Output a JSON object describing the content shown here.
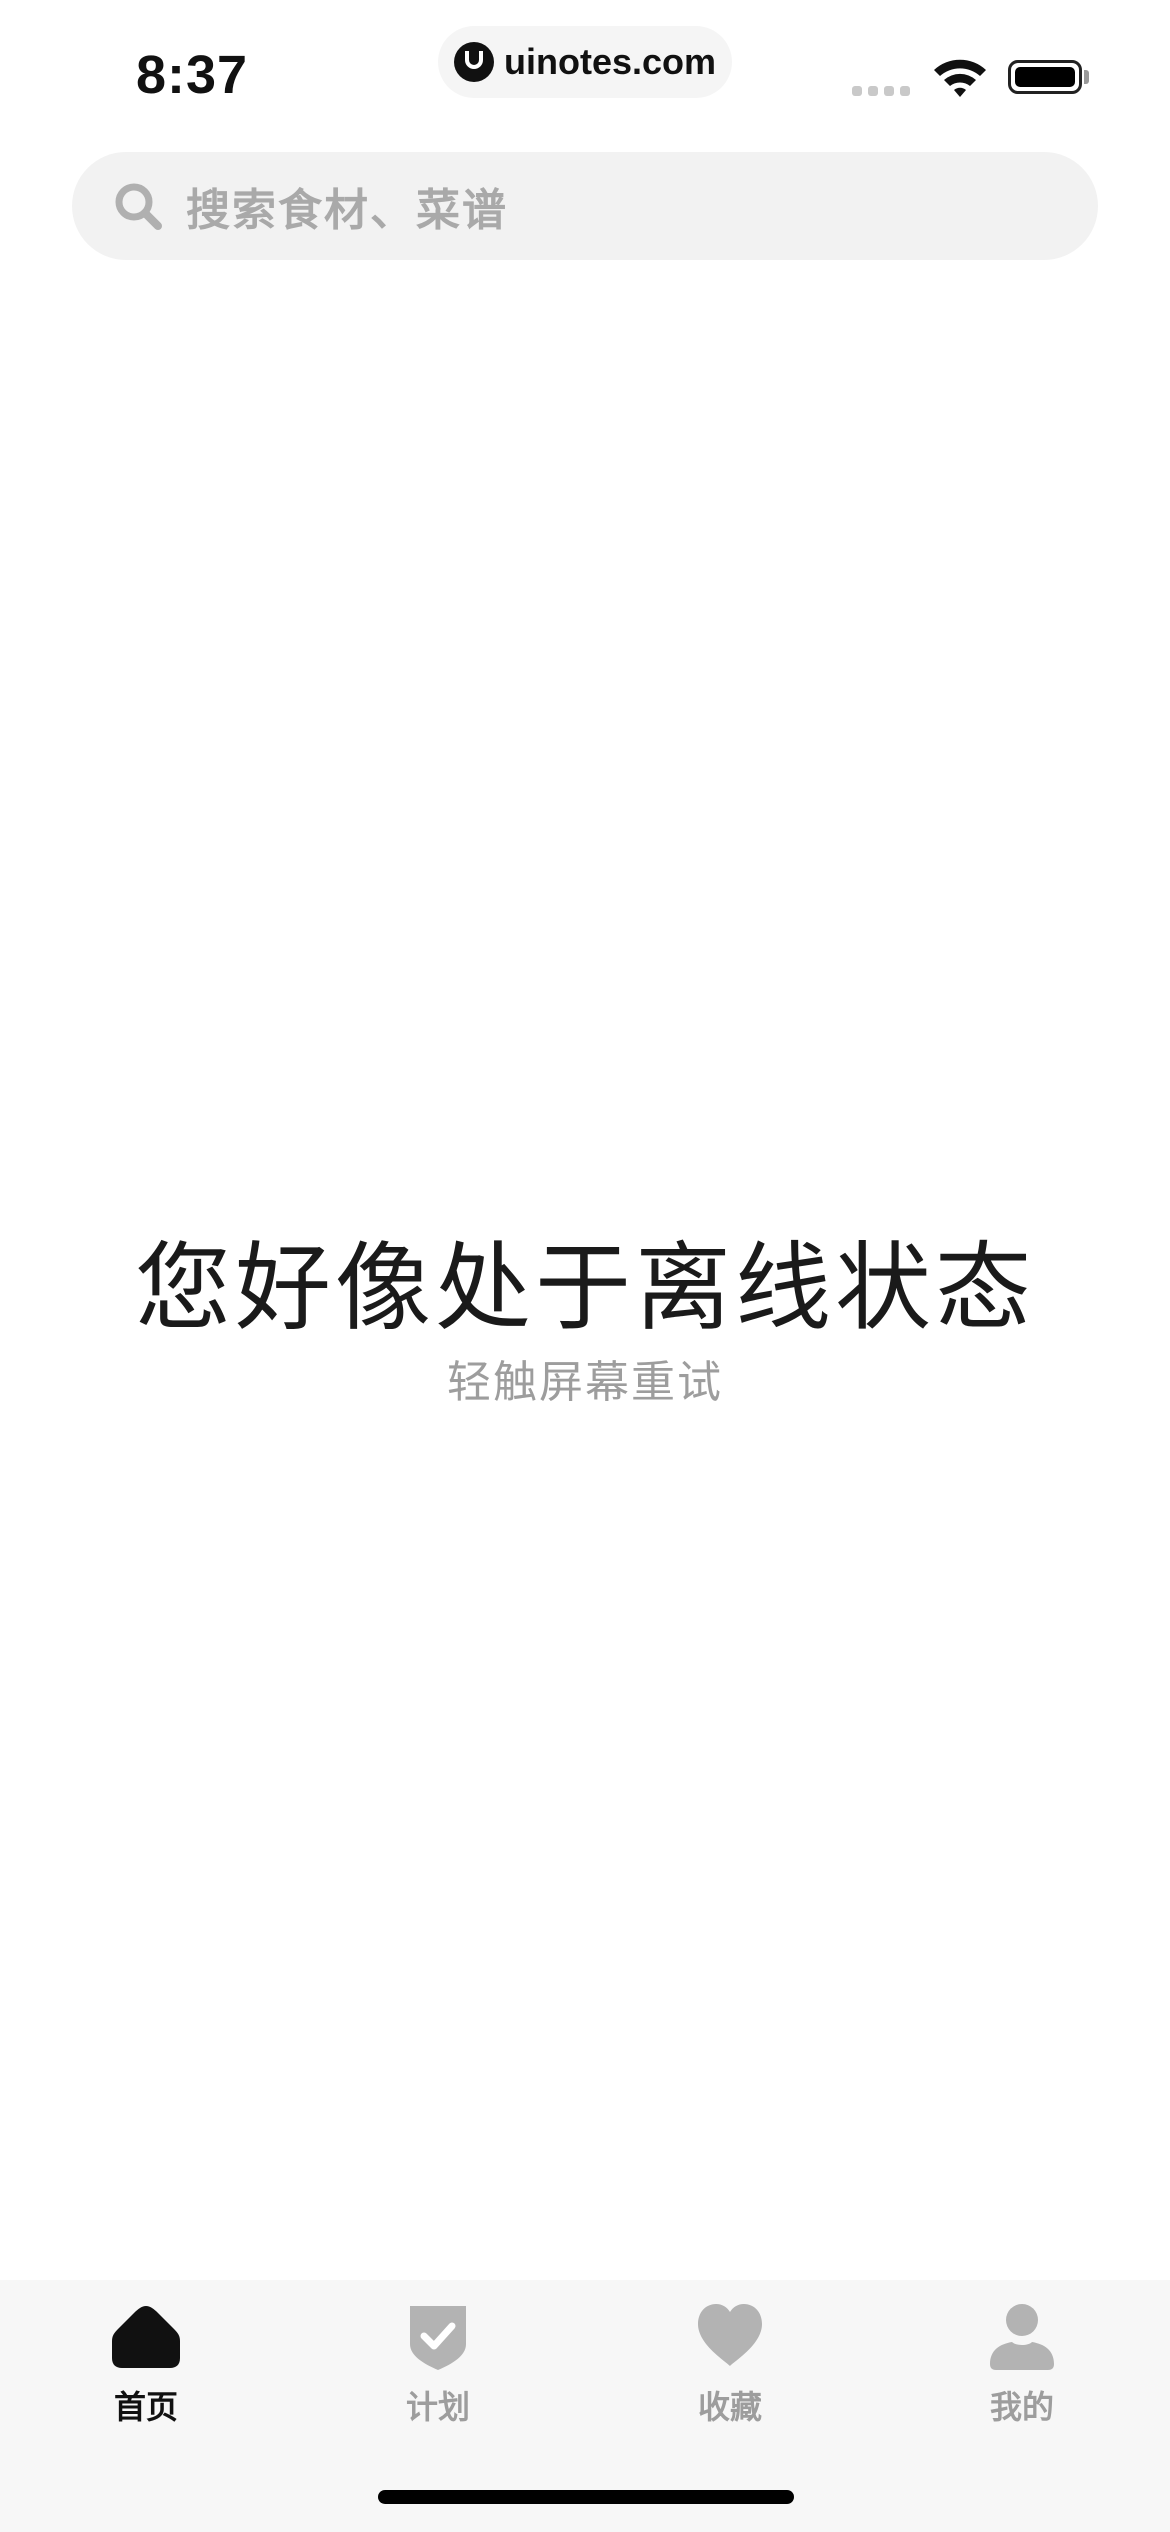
{
  "status_bar": {
    "time": "8:37",
    "url": "uinotes.com"
  },
  "search": {
    "placeholder": "搜索食材、菜谱"
  },
  "offline": {
    "title": "您好像处于离线状态",
    "subtitle": "轻触屏幕重试"
  },
  "tabs": [
    {
      "label": "首页",
      "icon": "home-icon",
      "active": true
    },
    {
      "label": "计划",
      "icon": "shield-check-icon",
      "active": false
    },
    {
      "label": "收藏",
      "icon": "heart-icon",
      "active": false
    },
    {
      "label": "我的",
      "icon": "user-icon",
      "active": false
    }
  ],
  "colors": {
    "active": "#111111",
    "inactive": "#a9a9a9",
    "search_bg": "#f2f2f2",
    "tab_bg": "#f7f7f7"
  }
}
